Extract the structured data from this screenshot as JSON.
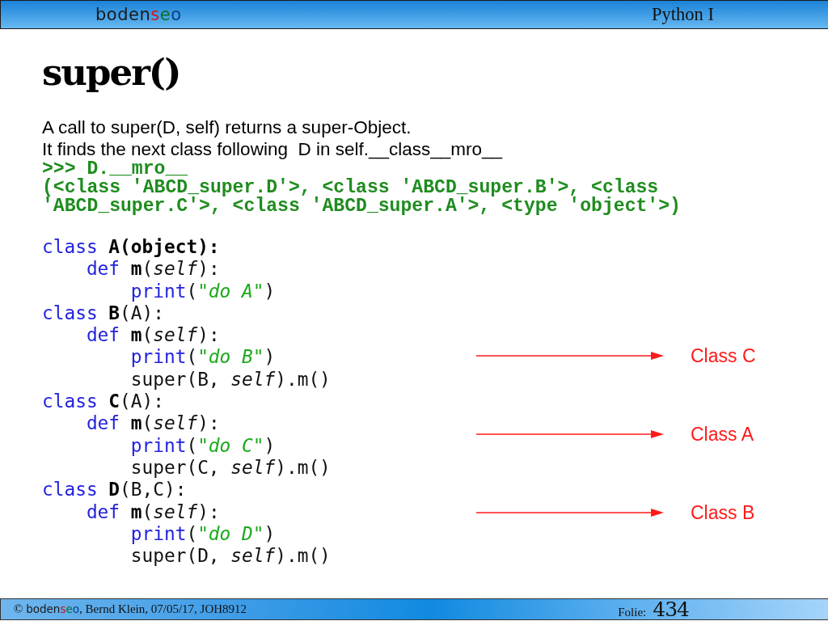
{
  "header": {
    "logo": [
      {
        "text": "boden",
        "color": "#1a1a1a"
      },
      {
        "text": "s",
        "color": "#d4161e"
      },
      {
        "text": "e",
        "color": "#0f6e24"
      },
      {
        "text": "o",
        "color": "#0a3f86"
      }
    ],
    "course": "Python I"
  },
  "title": "super()",
  "intro": [
    "A call to super(D, self) returns a super-Object.",
    "It finds the next class following  D in self.__class__mro__"
  ],
  "console": [
    ">>> D.__mro__",
    "(<class 'ABCD_super.D'>, <class 'ABCD_super.B'>, <class",
    "'ABCD_super.C'>, <class 'ABCD_super.A'>, <type 'object'>)"
  ],
  "code": [
    {
      "tokens": [
        {
          "kind": "keyword",
          "text": "class"
        },
        {
          "kind": "name",
          "text": " A(object):"
        }
      ],
      "children": [
        {
          "tokens": [
            {
              "kind": "keyword",
              "text": "def"
            },
            {
              "kind": "name",
              "text": " m"
            },
            {
              "kind": "text",
              "text": "("
            },
            {
              "kind": "param",
              "text": "self"
            },
            {
              "kind": "text",
              "text": "):"
            }
          ],
          "children": [
            {
              "tokens": [
                {
                  "kind": "keyword",
                  "text": "print"
                },
                {
                  "kind": "text",
                  "text": "("
                },
                {
                  "kind": "string",
                  "text": "\"do A\""
                },
                {
                  "kind": "text",
                  "text": ")"
                }
              ]
            }
          ]
        }
      ]
    },
    {
      "tokens": [
        {
          "kind": "keyword",
          "text": "class"
        },
        {
          "kind": "name",
          "text": " B"
        },
        {
          "kind": "text",
          "text": "(A):"
        }
      ],
      "children": [
        {
          "tokens": [
            {
              "kind": "keyword",
              "text": "def"
            },
            {
              "kind": "name",
              "text": " m"
            },
            {
              "kind": "text",
              "text": "("
            },
            {
              "kind": "param",
              "text": "self"
            },
            {
              "kind": "text",
              "text": "):"
            }
          ],
          "children": [
            {
              "tokens": [
                {
                  "kind": "keyword",
                  "text": "print"
                },
                {
                  "kind": "text",
                  "text": "("
                },
                {
                  "kind": "string",
                  "text": "\"do B\""
                },
                {
                  "kind": "text",
                  "text": ")"
                }
              ]
            },
            {
              "tokens": [
                {
                  "kind": "text",
                  "text": "super(B, "
                },
                {
                  "kind": "param",
                  "text": "self"
                },
                {
                  "kind": "text",
                  "text": ").m()"
                }
              ]
            }
          ]
        }
      ]
    },
    {
      "tokens": [
        {
          "kind": "keyword",
          "text": "class"
        },
        {
          "kind": "name",
          "text": " C"
        },
        {
          "kind": "text",
          "text": "(A):"
        }
      ],
      "children": [
        {
          "tokens": [
            {
              "kind": "keyword",
              "text": "def"
            },
            {
              "kind": "name",
              "text": " m"
            },
            {
              "kind": "text",
              "text": "("
            },
            {
              "kind": "param",
              "text": "self"
            },
            {
              "kind": "text",
              "text": "):"
            }
          ],
          "children": [
            {
              "tokens": [
                {
                  "kind": "keyword",
                  "text": "print"
                },
                {
                  "kind": "text",
                  "text": "("
                },
                {
                  "kind": "string",
                  "text": "\"do C\""
                },
                {
                  "kind": "text",
                  "text": ")"
                }
              ]
            },
            {
              "tokens": [
                {
                  "kind": "text",
                  "text": "super(C, "
                },
                {
                  "kind": "param",
                  "text": "self"
                },
                {
                  "kind": "text",
                  "text": ").m()"
                }
              ]
            }
          ]
        }
      ]
    },
    {
      "tokens": [
        {
          "kind": "keyword",
          "text": "class"
        },
        {
          "kind": "name",
          "text": " D"
        },
        {
          "kind": "text",
          "text": "(B,C):"
        }
      ],
      "children": [
        {
          "tokens": [
            {
              "kind": "keyword",
              "text": "def"
            },
            {
              "kind": "name",
              "text": " m"
            },
            {
              "kind": "text",
              "text": "("
            },
            {
              "kind": "param",
              "text": "self"
            },
            {
              "kind": "text",
              "text": "):"
            }
          ],
          "children": [
            {
              "tokens": [
                {
                  "kind": "keyword",
                  "text": "print"
                },
                {
                  "kind": "text",
                  "text": "("
                },
                {
                  "kind": "string",
                  "text": "\"do D\""
                },
                {
                  "kind": "text",
                  "text": ")"
                }
              ]
            },
            {
              "tokens": [
                {
                  "kind": "text",
                  "text": "super(D, "
                },
                {
                  "kind": "param",
                  "text": "self"
                },
                {
                  "kind": "text",
                  "text": ").m()"
                }
              ]
            }
          ]
        }
      ]
    }
  ],
  "annotations": [
    {
      "label": "Class C"
    },
    {
      "label": "Class A"
    },
    {
      "label": "Class B"
    }
  ],
  "footer": {
    "copyright": "©",
    "logo": [
      {
        "text": "boden",
        "color": "#1a1a1a"
      },
      {
        "text": "s",
        "color": "#c8141c"
      },
      {
        "text": "e",
        "color": "#0f6e24"
      },
      {
        "text": "o",
        "color": "#0a3f86"
      }
    ],
    "credit": ", Bernd Klein, 07/05/17, JOH8912",
    "slide_label": "Folie:",
    "slide_number": "434"
  }
}
